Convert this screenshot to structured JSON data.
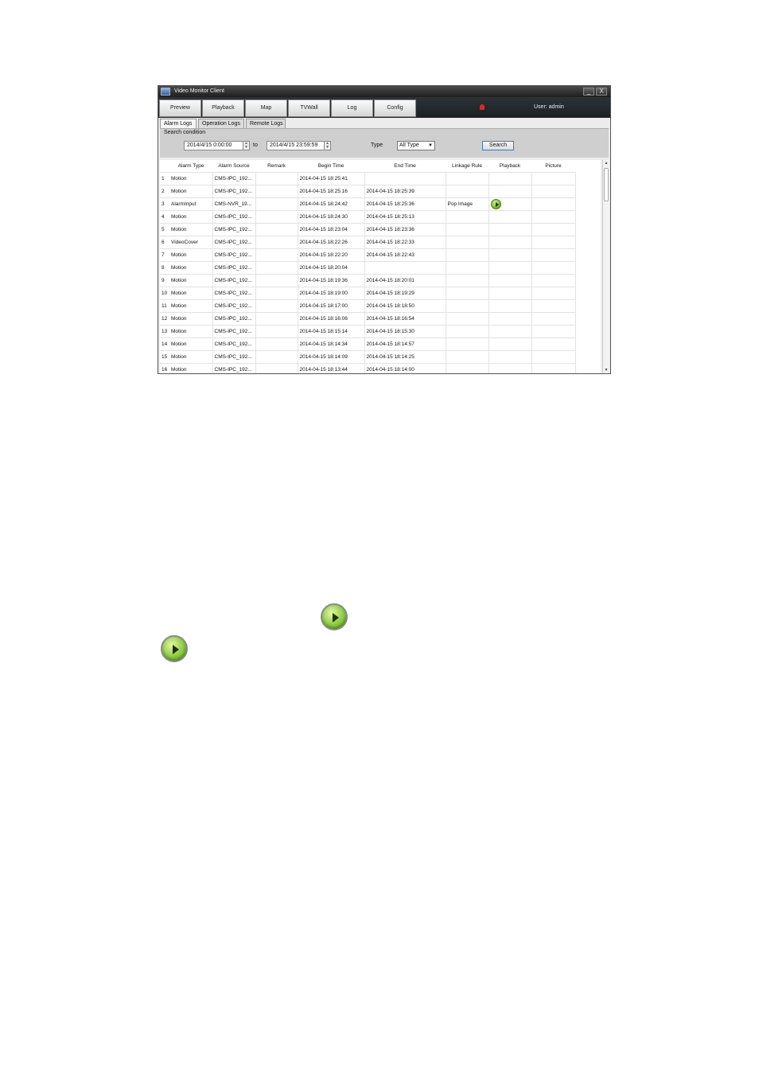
{
  "window": {
    "title": "Video Monitor Client",
    "minimize": "_",
    "close": "X"
  },
  "nav": {
    "tabs": [
      "Preview",
      "Playback",
      "Map",
      "TVWall",
      "Log",
      "Config"
    ],
    "user_label": "User: admin"
  },
  "subtabs": [
    "Alarm Logs",
    "Operation Logs",
    "Remote Logs"
  ],
  "search": {
    "title": "Search condition",
    "start": "2014/4/15 0:00:00",
    "to_label": "to",
    "end": "2014/4/15 23:59:59",
    "type_label": "Type",
    "type_value": "All Type",
    "button": "Search"
  },
  "table": {
    "headers": [
      "",
      "Alarm Type",
      "Alarm Source",
      "Remark",
      "Begin Time",
      "End Time",
      "Linkage Rule",
      "Playback",
      "Picture"
    ],
    "rows": [
      {
        "n": "1",
        "type": "Motion",
        "source": "CMS-IPC_192...",
        "remark": "",
        "begin": "2014-04-15 18:25:41",
        "end": "",
        "rule": "",
        "playback": false
      },
      {
        "n": "2",
        "type": "Motion",
        "source": "CMS-IPC_192...",
        "remark": "",
        "begin": "2014-04-15 18:25:16",
        "end": "2014-04-15 18:25:39",
        "rule": "",
        "playback": false
      },
      {
        "n": "3",
        "type": "AlarmInput",
        "source": "CMS-NVR_19...",
        "remark": "",
        "begin": "2014-04-15 18:24:42",
        "end": "2014-04-15 18:25:36",
        "rule": "Pop Image",
        "playback": true
      },
      {
        "n": "4",
        "type": "Motion",
        "source": "CMS-IPC_192...",
        "remark": "",
        "begin": "2014-04-15 18:24:30",
        "end": "2014-04-15 18:25:13",
        "rule": "",
        "playback": false
      },
      {
        "n": "5",
        "type": "Motion",
        "source": "CMS-IPC_192...",
        "remark": "",
        "begin": "2014-04-15 18:23:04",
        "end": "2014-04-15 18:23:36",
        "rule": "",
        "playback": false
      },
      {
        "n": "6",
        "type": "VideoCover",
        "source": "CMS-IPC_192...",
        "remark": "",
        "begin": "2014-04-15 18:22:26",
        "end": "2014-04-15 18:22:33",
        "rule": "",
        "playback": false
      },
      {
        "n": "7",
        "type": "Motion",
        "source": "CMS-IPC_192...",
        "remark": "",
        "begin": "2014-04-15 18:22:20",
        "end": "2014-04-15 18:22:43",
        "rule": "",
        "playback": false
      },
      {
        "n": "8",
        "type": "Motion",
        "source": "CMS-IPC_192...",
        "remark": "",
        "begin": "2014-04-15 18:20:04",
        "end": "",
        "rule": "",
        "playback": false
      },
      {
        "n": "9",
        "type": "Motion",
        "source": "CMS-IPC_192...",
        "remark": "",
        "begin": "2014-04-15 18:19:36",
        "end": "2014-04-15 18:20:01",
        "rule": "",
        "playback": false
      },
      {
        "n": "10",
        "type": "Motion",
        "source": "CMS-IPC_192...",
        "remark": "",
        "begin": "2014-04-15 18:19:00",
        "end": "2014-04-15 18:19:29",
        "rule": "",
        "playback": false
      },
      {
        "n": "11",
        "type": "Motion",
        "source": "CMS-IPC_192...",
        "remark": "",
        "begin": "2014-04-15 18:17:00",
        "end": "2014-04-15 18:18:50",
        "rule": "",
        "playback": false
      },
      {
        "n": "12",
        "type": "Motion",
        "source": "CMS-IPC_192...",
        "remark": "",
        "begin": "2014-04-15 18:16:06",
        "end": "2014-04-15 18:16:54",
        "rule": "",
        "playback": false
      },
      {
        "n": "13",
        "type": "Motion",
        "source": "CMS-IPC_192...",
        "remark": "",
        "begin": "2014-04-15 18:15:14",
        "end": "2014-04-15 18:15:30",
        "rule": "",
        "playback": false
      },
      {
        "n": "14",
        "type": "Motion",
        "source": "CMS-IPC_192...",
        "remark": "",
        "begin": "2014-04-15 18:14:34",
        "end": "2014-04-15 18:14:57",
        "rule": "",
        "playback": false
      },
      {
        "n": "15",
        "type": "Motion",
        "source": "CMS-IPC_192...",
        "remark": "",
        "begin": "2014-04-15 18:14:09",
        "end": "2014-04-15 18:14:25",
        "rule": "",
        "playback": false
      },
      {
        "n": "16",
        "type": "Motion",
        "source": "CMS-IPC_192...",
        "remark": "",
        "begin": "2014-04-15 18:13:44",
        "end": "2014-04-15 18:14:00",
        "rule": "",
        "playback": false
      }
    ]
  },
  "icons": {
    "playback": "play-button-icon",
    "alarm": "alarm-light-icon"
  },
  "colors": {
    "play_green": "#6ab22a",
    "alarm_red": "#e0281e",
    "nav_dark": "#1b2024"
  }
}
